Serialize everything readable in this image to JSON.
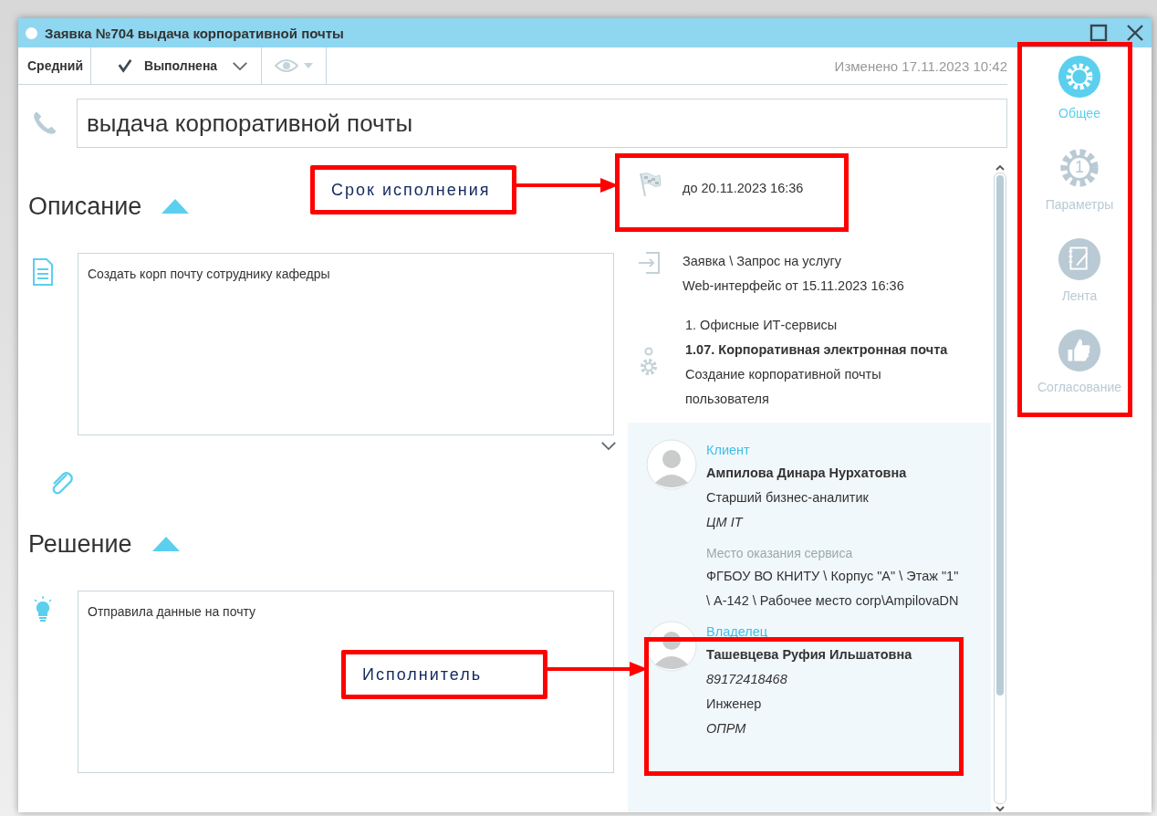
{
  "window": {
    "title": "Заявка №704 выдача корпоративной почты"
  },
  "toolbar": {
    "priority": "Средний",
    "status": {
      "label": "Выполнена",
      "done": true
    },
    "modified": "Изменено 17.11.2023 10:42"
  },
  "subject": "выдача корпоративной почты",
  "description": {
    "heading": "Описание",
    "expanded": true,
    "text": "Создать корп почту сотруднику кафедры"
  },
  "solution": {
    "heading": "Решение",
    "expanded": true,
    "text": "Отправила данные на почту"
  },
  "details": {
    "deadline": "до 20.11.2023 16:36",
    "source": [
      "Заявка \\ Запрос на услугу",
      "Web-интерфейс от 15.11.2023 16:36"
    ],
    "service": {
      "category": "1. Офисные ИТ-сервисы",
      "item": "1.07. Корпоративная электронная почта",
      "description": "Создание корпоративной почты пользователя"
    },
    "client": {
      "role": "Клиент",
      "name": "Ампилова Динара Нурхатовна",
      "position": "Старший бизнес-аналитик",
      "department": "ЦМ IT",
      "location_label": "Место оказания сервиса",
      "location": "ФГБОУ ВО КНИТУ \\ Корпус \"А\" \\ Этаж \"1\" \\ А-142 \\ Рабочее место corp\\AmpilovaDN"
    },
    "owner": {
      "role": "Владелец",
      "name": "Ташевцева Руфия Ильшатовна",
      "phone": "89172418468",
      "position": "Инженер",
      "department": "ОПРМ"
    }
  },
  "nav": [
    {
      "kind": "gear",
      "label": "Общее",
      "selected": true
    },
    {
      "kind": "params",
      "label": "Параметры",
      "badge": "1",
      "selected": false
    },
    {
      "kind": "feed",
      "label": "Лента",
      "selected": false
    },
    {
      "kind": "approval",
      "label": "Согласование",
      "selected": false
    }
  ],
  "annotations": [
    {
      "text": "Срок исполнения"
    },
    {
      "text": "Исполнитель"
    }
  ]
}
